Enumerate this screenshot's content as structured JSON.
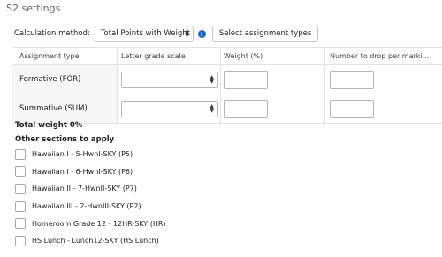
{
  "page": {
    "title": "S2 settings"
  },
  "calculation": {
    "label": "Calculation method:",
    "selected": "Total Points with Weight",
    "select_types_label": "Select assignment types"
  },
  "grid": {
    "headers": [
      "Assignment type",
      "Letter grade scale",
      "Weight (%)",
      "Number to drop per marki..."
    ],
    "rows": [
      {
        "label": "Formative (FOR)",
        "grade_scale": "",
        "weight": "",
        "drop": ""
      },
      {
        "label": "Summative (SUM)",
        "grade_scale": "",
        "weight": "",
        "drop": ""
      }
    ]
  },
  "total_weight": "Total weight 0%",
  "other_sections": {
    "heading": "Other sections to apply",
    "items": [
      {
        "label": "Hawaiian I - 5-HwnI-SKY (P5)",
        "checked": false
      },
      {
        "label": "Hawaiian I - 6-HwnI-SKY (P6)",
        "checked": false
      },
      {
        "label": "Hawaiian II - 7-HwnII-SKY (P7)",
        "checked": false
      },
      {
        "label": "Hawaiian III - 2-HwnIII-SKY (P2)",
        "checked": false
      },
      {
        "label": "Homeroom Grade 12 - 12HR-SKY (HR)",
        "checked": false
      },
      {
        "label": "HS Lunch - Lunch12-SKY (HS Lunch)",
        "checked": false
      }
    ]
  },
  "colors": {
    "info_icon": "#1565c0",
    "border": "#e2e2e2",
    "label_cell_bg": "#f7f7f7"
  },
  "icons": {
    "info": "info-icon",
    "select_arrows": "updown-arrows-icon"
  }
}
